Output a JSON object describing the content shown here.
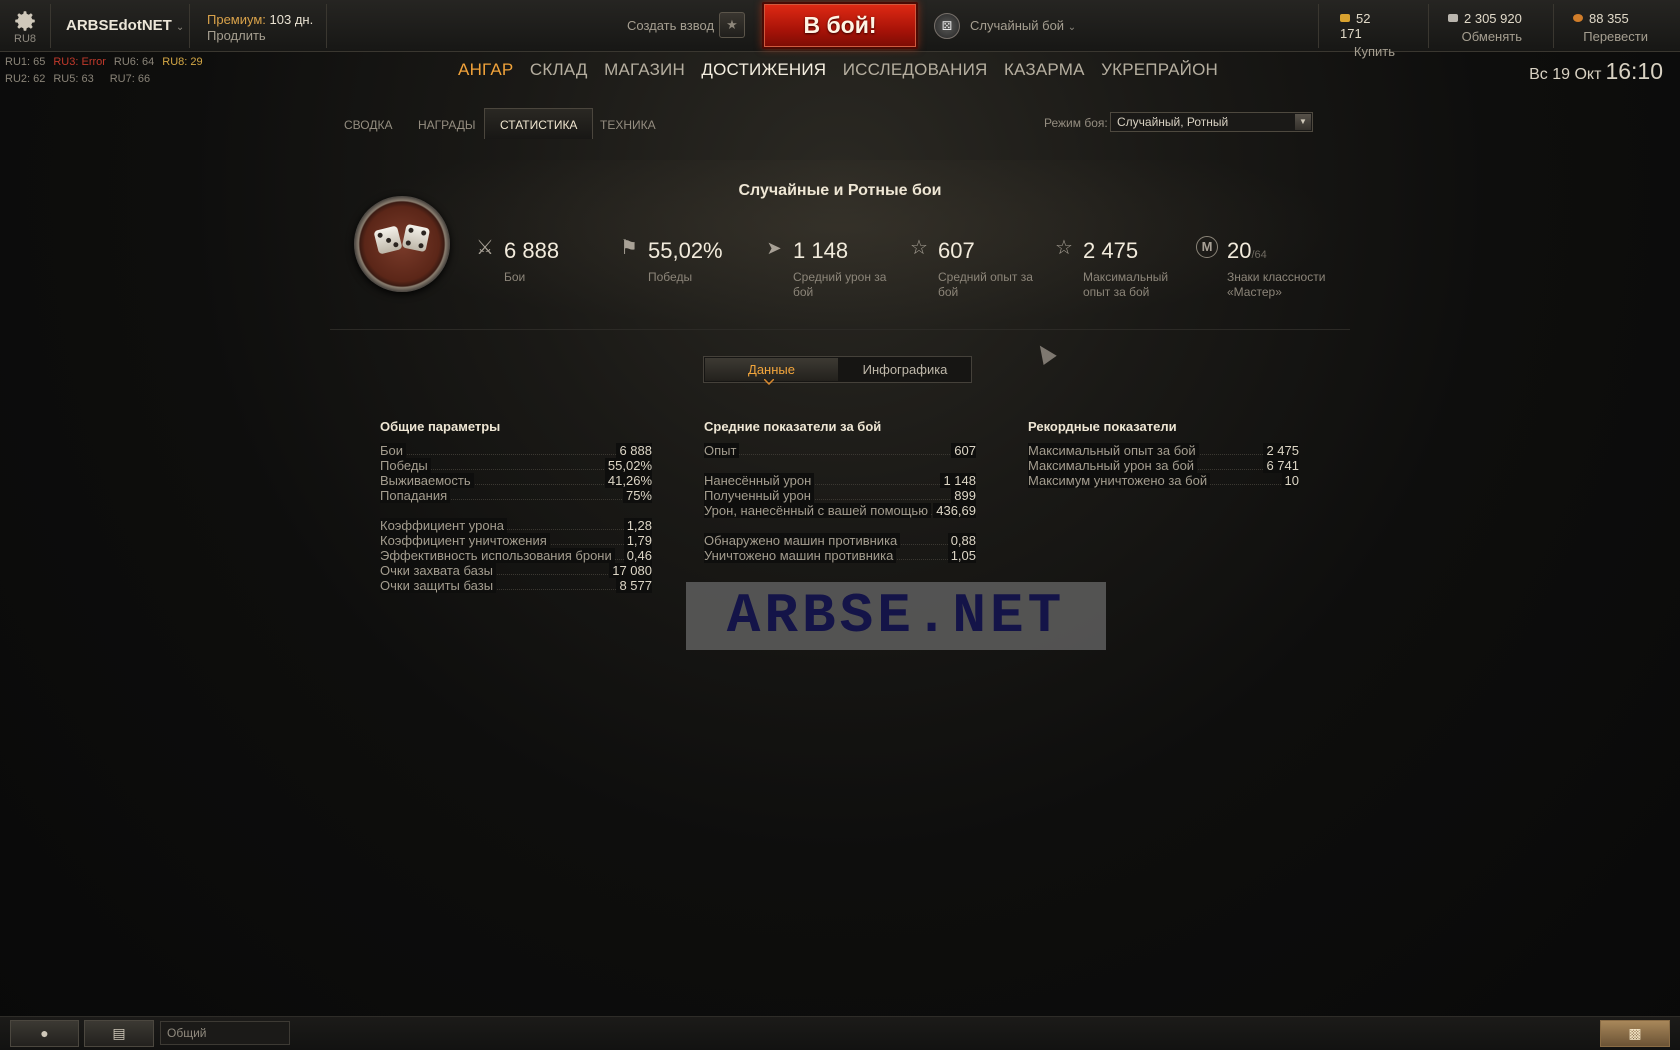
{
  "topbar": {
    "server": "RU8",
    "account_name": "ARBSEdotNET",
    "premium_label": "Премиум:",
    "premium_days": "103 дн.",
    "extend_label": "Продлить",
    "platoon_label": "Создать взвод",
    "battle_label": "В бой!",
    "battle_mode": "Случайный бой",
    "currencies": [
      {
        "value": "52 171",
        "action": "Купить",
        "color": "#d9a22f",
        "icon": "gold-icon"
      },
      {
        "value": "2 305 920",
        "action": "Обменять",
        "color": "#b9b5ad",
        "icon": "credits-icon"
      },
      {
        "value": "88 355",
        "action": "Перевести",
        "color": "#d07d2a",
        "icon": "free-xp-icon"
      }
    ]
  },
  "pings": {
    "row1": [
      "RU1: 65",
      "RU3: Error",
      "RU6: 64",
      "RU8: 29"
    ],
    "row2": [
      "RU2: 62",
      "RU5: 63",
      "RU7: 66"
    ]
  },
  "nav": {
    "items": [
      "АНГАР",
      "СКЛАД",
      "МАГАЗИН",
      "ДОСТИЖЕНИЯ",
      "ИССЛЕДОВАНИЯ",
      "КАЗАРМА",
      "УКРЕПРАЙОН"
    ],
    "active": "ДОСТИЖЕНИЯ"
  },
  "clock": {
    "date": "Вс 19 Окт",
    "time": "16:10"
  },
  "subtabs": {
    "items": [
      "СВОДКА",
      "НАГРАДЫ",
      "СТАТИСТИКА",
      "ТЕХНИКА"
    ],
    "active": "СТАТИСТИКА",
    "mode_label": "Режим боя:",
    "mode_value": "Случайный, Ротный"
  },
  "summary": {
    "title": "Случайные и Ротные бои",
    "stats": [
      {
        "icon": "battles-icon",
        "value": "6 888",
        "label": "Бои"
      },
      {
        "icon": "victories-icon",
        "value": "55,02%",
        "label": "Победы"
      },
      {
        "icon": "damage-icon",
        "value": "1 148",
        "label": "Средний урон за бой"
      },
      {
        "icon": "avg-xp-icon",
        "value": "607",
        "label": "Средний опыт за бой"
      },
      {
        "icon": "max-xp-icon",
        "value": "2 475",
        "label": "Максимальный опыт за бой"
      },
      {
        "icon": "mastery-icon",
        "value": "20",
        "suffix": "/64",
        "label": "Знаки классности «Мастер»"
      }
    ]
  },
  "view_toggle": {
    "data_label": "Данные",
    "infographic_label": "Инфографика",
    "active": "Данные"
  },
  "tables": {
    "general": {
      "title": "Общие параметры",
      "groups": [
        [
          {
            "k": "Бои",
            "v": "6 888"
          },
          {
            "k": "Победы",
            "v": "55,02%"
          },
          {
            "k": "Выживаемость",
            "v": "41,26%"
          },
          {
            "k": "Попадания",
            "v": "75%"
          }
        ],
        [
          {
            "k": "Коэффициент урона",
            "v": "1,28"
          },
          {
            "k": "Коэффициент уничтожения",
            "v": "1,79"
          },
          {
            "k": "Эффективность использования брони",
            "v": "0,46"
          },
          {
            "k": "Очки захвата базы",
            "v": "17 080"
          },
          {
            "k": "Очки защиты базы",
            "v": "8 577"
          }
        ]
      ]
    },
    "average": {
      "title": "Средние показатели за бой",
      "groups": [
        [
          {
            "k": "Опыт",
            "v": "607"
          }
        ],
        [
          {
            "k": "Нанесённый урон",
            "v": "1 148"
          },
          {
            "k": "Полученный урон",
            "v": "899"
          },
          {
            "k": "Урон, нанесённый с вашей помощью",
            "v": "436,69"
          }
        ],
        [
          {
            "k": "Обнаружено машин противника",
            "v": "0,88"
          },
          {
            "k": "Уничтожено машин противника",
            "v": "1,05"
          }
        ]
      ]
    },
    "records": {
      "title": "Рекордные показатели",
      "groups": [
        [
          {
            "k": "Максимальный опыт за бой",
            "v": "2 475"
          },
          {
            "k": "Максимальный урон за бой",
            "v": "6 741"
          },
          {
            "k": "Максимум уничтожено за бой",
            "v": "10"
          }
        ]
      ]
    }
  },
  "watermark": "ARBSE.NET",
  "bottombar": {
    "chat_placeholder": "Общий"
  }
}
